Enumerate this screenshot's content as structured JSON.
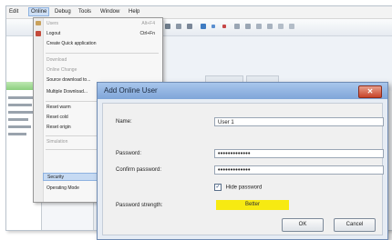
{
  "menubar": {
    "items": [
      "Edit",
      "Online",
      "Debug",
      "Tools",
      "Window",
      "Help"
    ]
  },
  "online_menu": {
    "items": [
      {
        "label": "Users",
        "shortcut": "Alt+F4"
      },
      {
        "label": "Logout",
        "shortcut": "Ctrl+Fn"
      },
      {
        "label": "Create Quick application",
        "shortcut": ""
      },
      {
        "label": "Download",
        "shortcut": ""
      },
      {
        "label": "Online Change",
        "shortcut": ""
      },
      {
        "label": "Source download to...",
        "shortcut": ""
      },
      {
        "label": "Multiple Download...",
        "shortcut": ""
      },
      {
        "label": "Reset warm",
        "shortcut": ""
      },
      {
        "label": "Reset cold",
        "shortcut": ""
      },
      {
        "label": "Reset origin",
        "shortcut": ""
      },
      {
        "label": "Simulation",
        "shortcut": ""
      },
      {
        "label": "Security",
        "shortcut": ""
      },
      {
        "label": "Operating Mode",
        "shortcut": ""
      }
    ]
  },
  "dialog": {
    "title": "Add Online User",
    "close_glyph": "✕",
    "name_label": "Name:",
    "name_value": "User 1",
    "password_label": "Password:",
    "password_value": "•••••••••••••",
    "confirm_label": "Confirm password:",
    "confirm_value": "•••••••••••••",
    "hide_password_label": "Hide password",
    "strength_label": "Password strength:",
    "strength_value": "Better",
    "strength_color": "#f7ea12",
    "ok_label": "OK",
    "cancel_label": "Cancel"
  }
}
